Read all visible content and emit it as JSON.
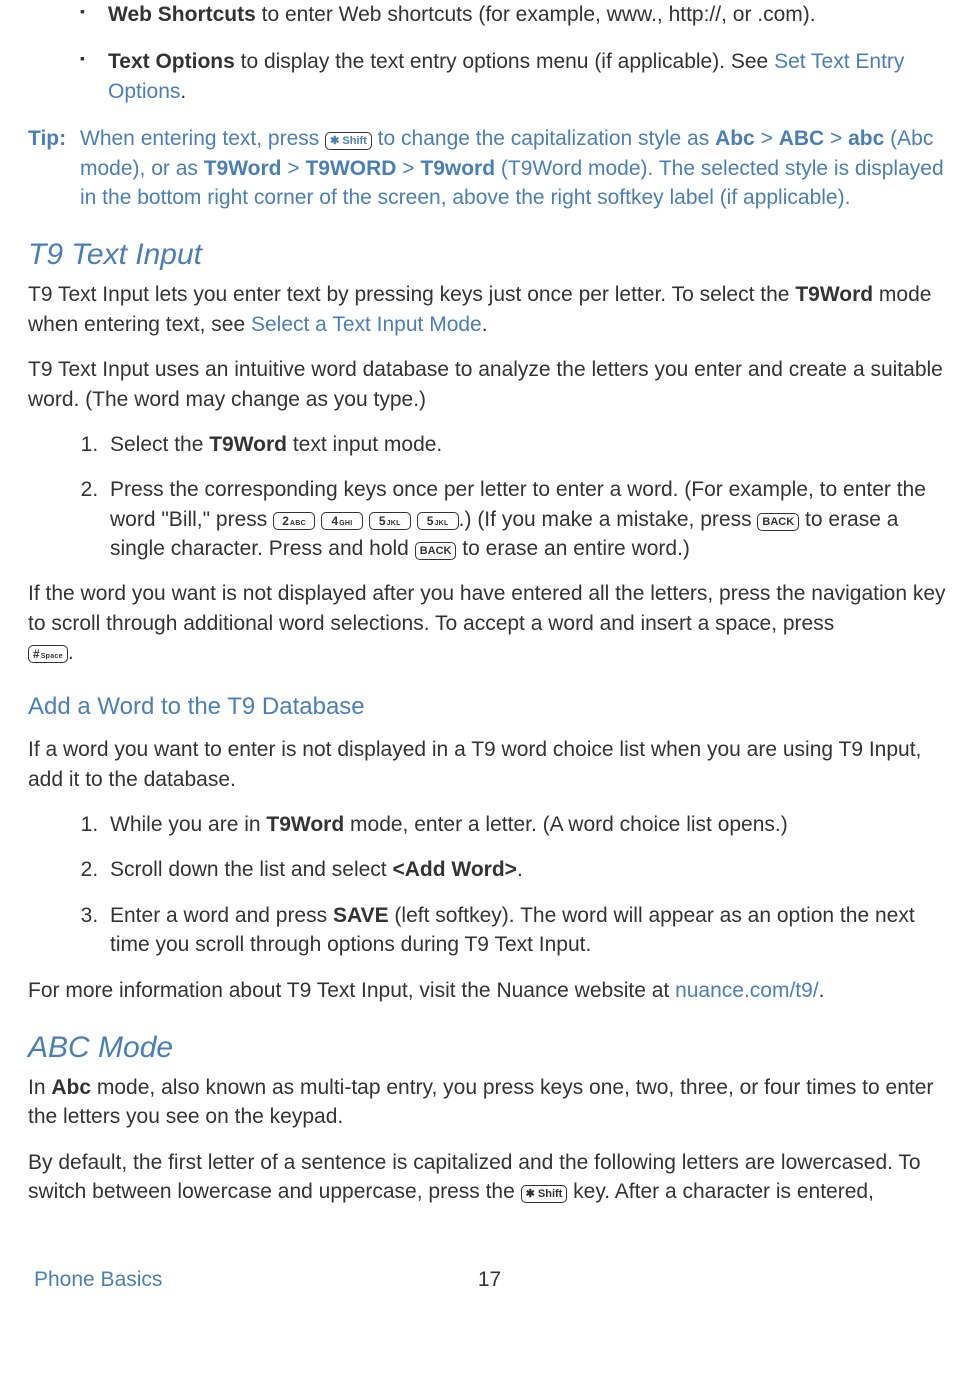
{
  "bullets": {
    "web_shortcuts_bold": "Web Shortcuts",
    "web_shortcuts_rest": " to enter Web shortcuts (for example, www., http://, or .com).",
    "text_options_bold": "Text Options",
    "text_options_mid": " to display the text entry options menu (if applicable). See ",
    "text_options_link": "Set Text Entry Options",
    "text_options_end": "."
  },
  "tip": {
    "label": "Tip:",
    "part1": "When entering text, press ",
    "key_shift": "✱ Shift",
    "part2": " to change the capitalization style as ",
    "abc1": "Abc",
    "gt1": " > ",
    "abc2": "ABC",
    "gt2": " > ",
    "abc3": "abc",
    "part3": " (Abc mode), or as ",
    "t9a": "T9Word",
    "gt3": " > ",
    "t9b": "T9WORD",
    "gt4": " > ",
    "t9c": "T9word",
    "part4": " (T9Word mode). The selected style is displayed in the bottom right corner of the screen, above the right softkey label (if applicable)."
  },
  "t9": {
    "heading": "T9 Text Input",
    "p1a": "T9 Text Input lets you enter text by pressing keys just once per letter. To select the ",
    "p1b": "T9Word",
    "p1c": " mode when entering text, see ",
    "p1link": "Select a Text Input Mode",
    "p1d": ".",
    "p2": "T9 Text Input uses an intuitive word database to analyze the letters you enter and create a suitable word. (The word may change as you type.)",
    "ol1a": "Select the ",
    "ol1b": "T9Word",
    "ol1c": " text input mode.",
    "ol2a": "Press the corresponding keys once per letter to enter a word. (For example, to enter the word \"Bill,\" press ",
    "key2": "2 ABC",
    "key4": "4 GHI",
    "key5a": "5 JKL",
    "key5b": "5 JKL",
    "ol2b": ".) (If you make a mistake, press ",
    "keyback": "BACK",
    "ol2c": " to erase a single character. Press and hold ",
    "ol2d": " to erase an entire word.)",
    "p3a": "If the word you want is not displayed after you have entered all the letters, press the navigation key to scroll through additional word selections. To accept a word and insert a space, press ",
    "keyhash": "# Space",
    "p3b": ".",
    "h3": "Add a Word to the T9 Database",
    "p4": "If a word you want to enter is not displayed in a T9 word choice list when you are using T9 Input, add it to the database.",
    "db1a": "While you are in ",
    "db1b": "T9Word",
    "db1c": " mode, enter a letter. (A word choice list opens.)",
    "db2a": "Scroll down the list and select ",
    "db2b": "<Add Word>",
    "db2c": ".",
    "db3a": "Enter a word and press ",
    "db3b": "SAVE",
    "db3c": " (left softkey). The word will appear as an option the next time you scroll through options during T9 Text Input.",
    "p5a": "For more information about T9 Text Input, visit the Nuance website at ",
    "p5link": "nuance.com/t9/",
    "p5b": "."
  },
  "abc": {
    "heading": "ABC Mode",
    "p1a": "In ",
    "p1b": "Abc",
    "p1c": " mode, also known as multi-tap entry, you press keys one, two, three, or four times to enter the letters you see on the keypad.",
    "p2a": "By default, the first letter of a sentence is capitalized and the following letters are lowercased. To switch between lowercase and uppercase, press the ",
    "p2b": " key. After a character is entered,"
  },
  "footer": {
    "left": "Phone Basics",
    "page": "17"
  }
}
